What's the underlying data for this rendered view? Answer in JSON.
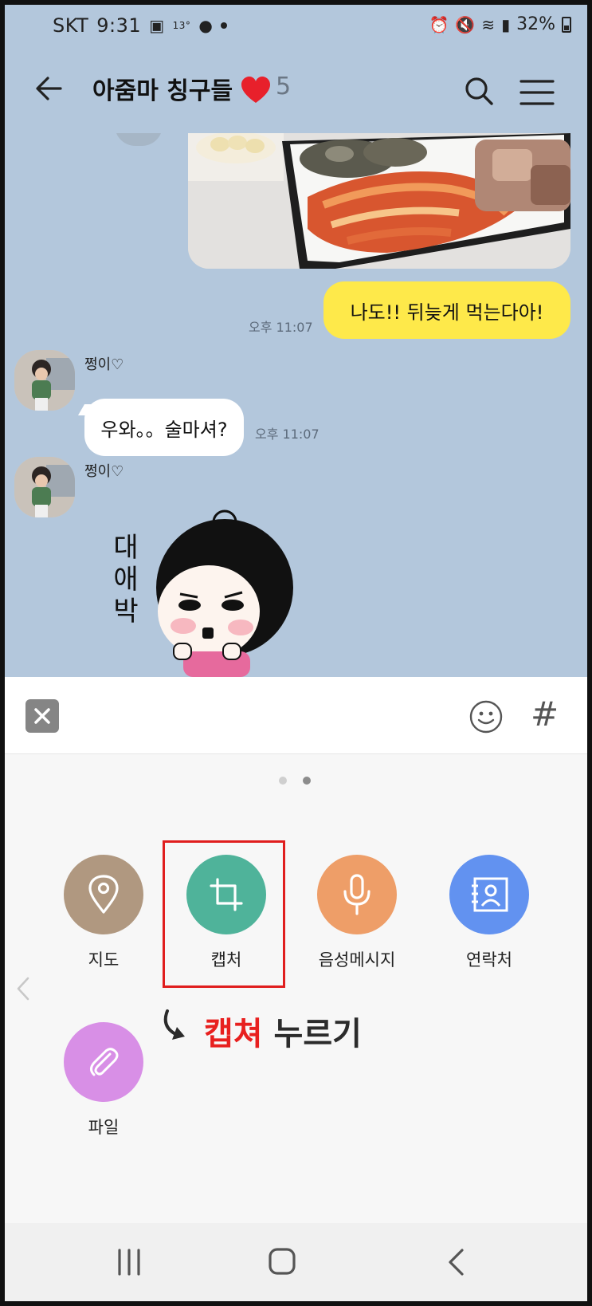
{
  "status_bar": {
    "carrier": "SKT",
    "time": "9:31",
    "temp": "13°",
    "battery_text": "32%"
  },
  "header": {
    "title": "아줌마 칭구들",
    "member_count": "5"
  },
  "messages": {
    "my_message": "나도!! 뒤늦게 먹는다아!",
    "my_time": "오후 11:07",
    "sender_name_1": "쩡이♡",
    "other_message": "우와。。술마셔?",
    "other_time": "오후 11:07",
    "sender_name_2": "쩡이♡",
    "sticker_text": "대애박"
  },
  "panel": {
    "page_indicator": {
      "total": 2,
      "active": 2
    },
    "items": [
      {
        "label": "지도",
        "icon": "map-pin-icon",
        "color": "#b09880"
      },
      {
        "label": "캡처",
        "icon": "crop-icon",
        "color": "#4fb39a"
      },
      {
        "label": "음성메시지",
        "icon": "microphone-icon",
        "color": "#ee9e68"
      },
      {
        "label": "연락처",
        "icon": "contact-card-icon",
        "color": "#6292f0"
      },
      {
        "label": "파일",
        "icon": "paperclip-icon",
        "color": "#d88fe6"
      }
    ],
    "annotation_red": "캡쳐",
    "annotation_rest": " 누르기"
  },
  "colors": {
    "chat_bg": "#b3c7dc",
    "my_bubble": "#fee94a",
    "highlight": "#e01e1e"
  }
}
